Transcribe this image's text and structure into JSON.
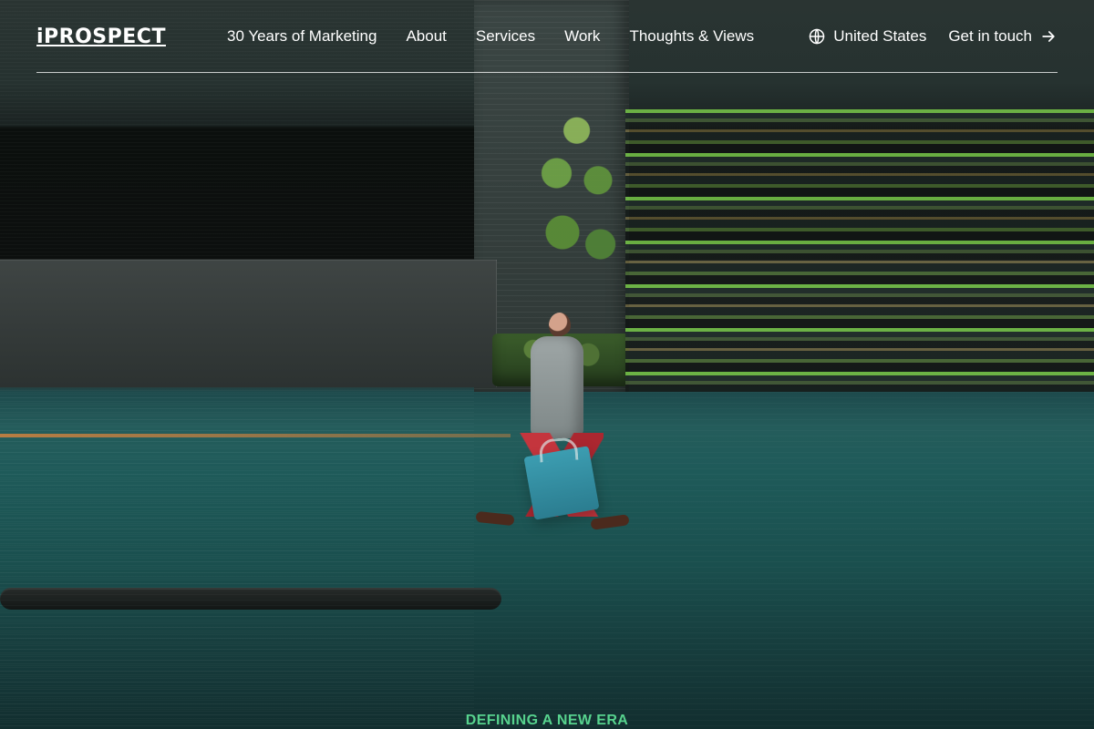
{
  "brand": {
    "name": "iPROSPECT"
  },
  "nav": {
    "items": [
      {
        "label": "30 Years of Marketing"
      },
      {
        "label": "About"
      },
      {
        "label": "Services"
      },
      {
        "label": "Work"
      },
      {
        "label": "Thoughts & Views"
      }
    ]
  },
  "header": {
    "region_label": "United States",
    "cta_label": "Get in touch"
  },
  "hero": {
    "eyebrow": "DEFINING A NEW ERA"
  },
  "icons": {
    "region": "globe-icon",
    "cta": "arrow-right-icon"
  },
  "colors": {
    "text": "#ffffff",
    "accent": "#57d38e"
  }
}
